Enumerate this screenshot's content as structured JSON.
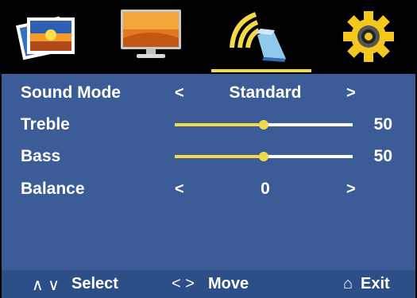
{
  "colors": {
    "panel": "#3c5c98",
    "footer": "#2b4f86",
    "accent": "#f2d94a",
    "text": "#ffffff"
  },
  "tabs": [
    {
      "name": "picture",
      "icon": "photo-icon"
    },
    {
      "name": "screen",
      "icon": "monitor-icon"
    },
    {
      "name": "sound",
      "icon": "speaker-icon",
      "selected": true
    },
    {
      "name": "setup",
      "icon": "gear-icon"
    }
  ],
  "settings": {
    "sound_mode": {
      "label": "Sound Mode",
      "left": "<",
      "value": "Standard",
      "right": ">"
    },
    "treble": {
      "label": "Treble",
      "value": "50",
      "level": 0.5
    },
    "bass": {
      "label": "Bass",
      "value": "50",
      "level": 0.5
    },
    "balance": {
      "label": "Balance",
      "left": "<",
      "value": "0",
      "right": ">"
    }
  },
  "footer": {
    "select_arrows": "∧ ∨",
    "select_label": "Select",
    "move_arrows": "<  >",
    "move_label": "Move",
    "exit_icon": "⌂",
    "exit_label": "Exit"
  }
}
